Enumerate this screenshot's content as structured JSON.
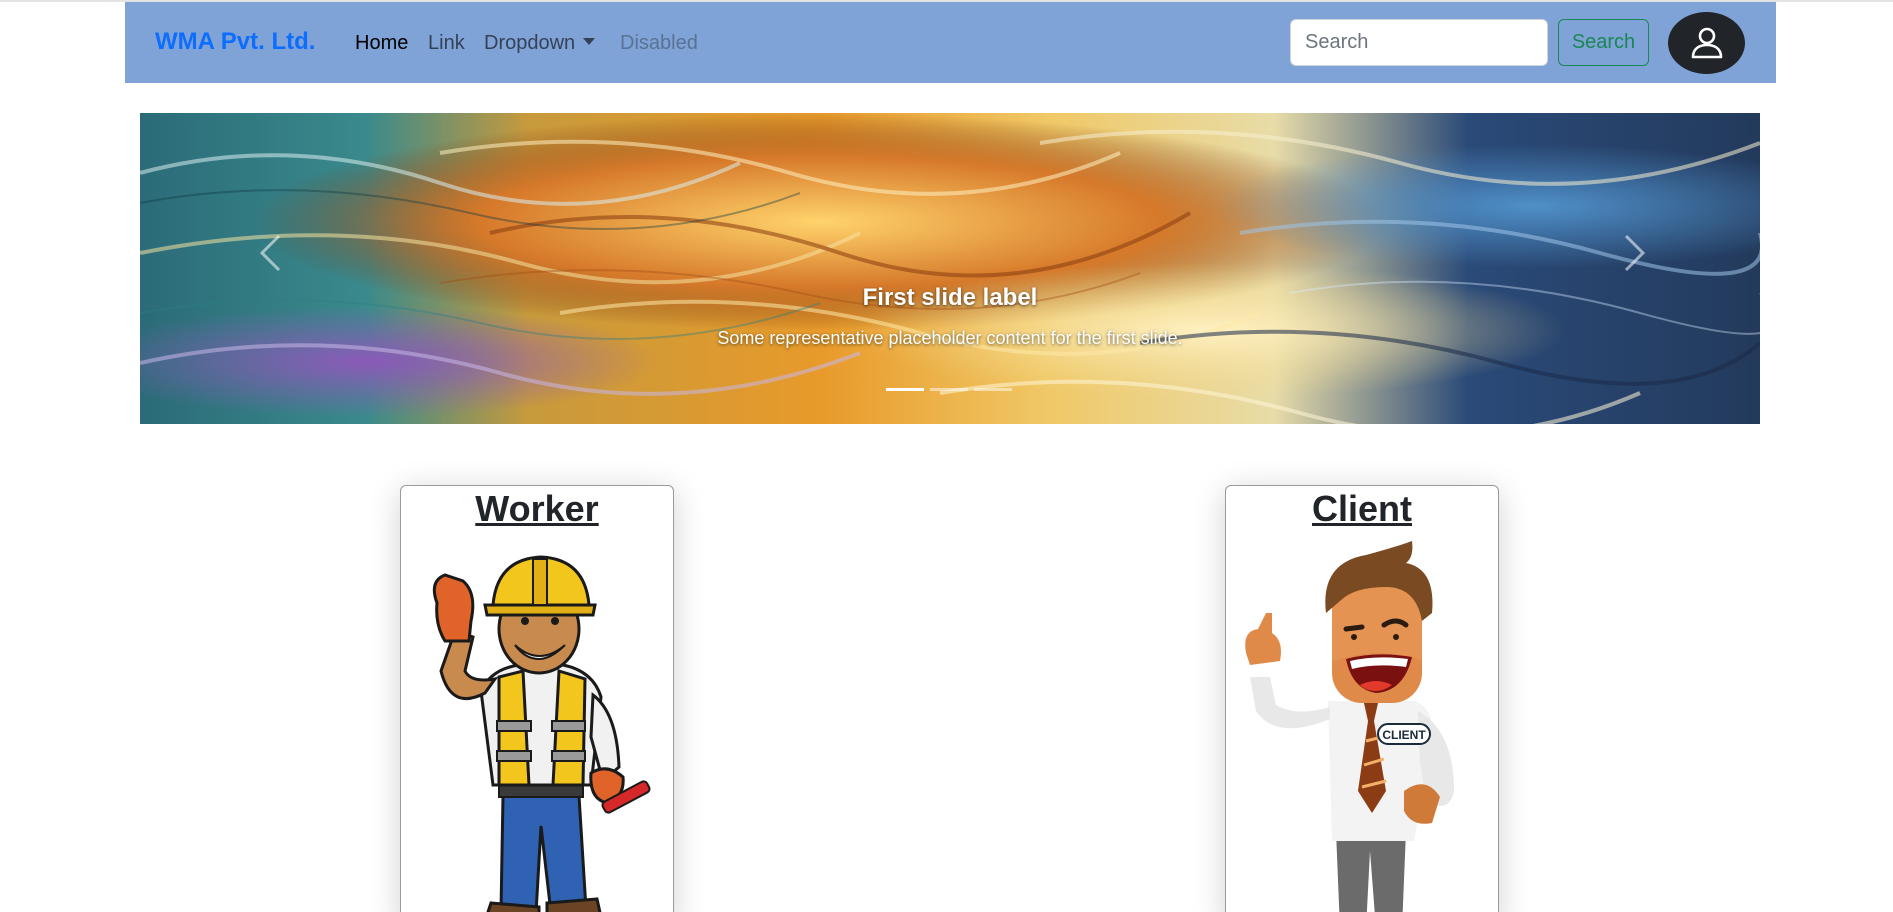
{
  "navbar": {
    "brand": "WMA Pvt. Ltd.",
    "links": {
      "home": "Home",
      "link": "Link",
      "dropdown": "Dropdown",
      "disabled": "Disabled"
    },
    "search": {
      "placeholder": "Search",
      "value": "",
      "button_label": "Search"
    },
    "avatar_icon": "person-icon",
    "colors": {
      "background": "#7fa3d6",
      "brand": "#0d6efd",
      "search_button": "#198754"
    }
  },
  "carousel": {
    "active_slide": {
      "title": "First slide label",
      "text": "Some representative placeholder content for the first slide."
    },
    "slide_count": 3,
    "active_index": 0,
    "prev_icon": "chevron-left-icon",
    "next_icon": "chevron-right-icon"
  },
  "cards": {
    "worker": {
      "title": "Worker",
      "illustration": "construction-worker-illustration"
    },
    "client": {
      "title": "Client",
      "illustration": "businessman-illustration",
      "badge_text": "CLIENT"
    }
  }
}
